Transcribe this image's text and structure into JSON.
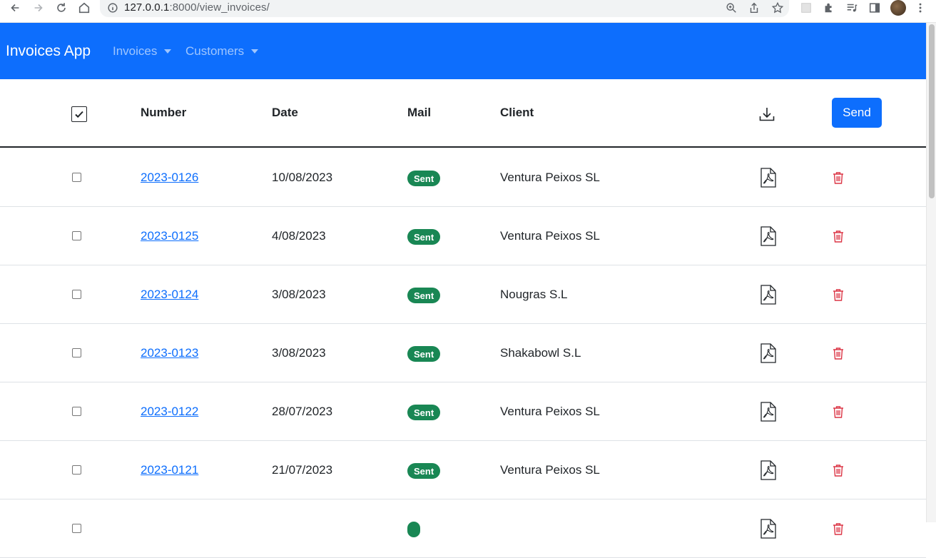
{
  "browser": {
    "url_host": "127.0.0.1",
    "url_rest": ":8000/view_invoices/"
  },
  "navbar": {
    "brand": "Invoices App",
    "menu_invoices": "Invoices",
    "menu_customers": "Customers"
  },
  "table": {
    "headers": {
      "number": "Number",
      "date": "Date",
      "mail": "Mail",
      "client": "Client"
    },
    "send_label": "Send",
    "rows": [
      {
        "number": "2023-0126",
        "date": "10/08/2023",
        "mail": "Sent",
        "client": "Ventura Peixos SL"
      },
      {
        "number": "2023-0125",
        "date": "4/08/2023",
        "mail": "Sent",
        "client": "Ventura Peixos SL"
      },
      {
        "number": "2023-0124",
        "date": "3/08/2023",
        "mail": "Sent",
        "client": "Nougras S.L"
      },
      {
        "number": "2023-0123",
        "date": "3/08/2023",
        "mail": "Sent",
        "client": "Shakabowl S.L"
      },
      {
        "number": "2023-0122",
        "date": "28/07/2023",
        "mail": "Sent",
        "client": "Ventura Peixos SL"
      },
      {
        "number": "2023-0121",
        "date": "21/07/2023",
        "mail": "Sent",
        "client": "Ventura Peixos SL"
      },
      {
        "number": "",
        "date": "",
        "mail": "",
        "client": ""
      }
    ]
  },
  "colors": {
    "primary": "#0d6efd",
    "success": "#198754",
    "danger": "#dc3545"
  }
}
